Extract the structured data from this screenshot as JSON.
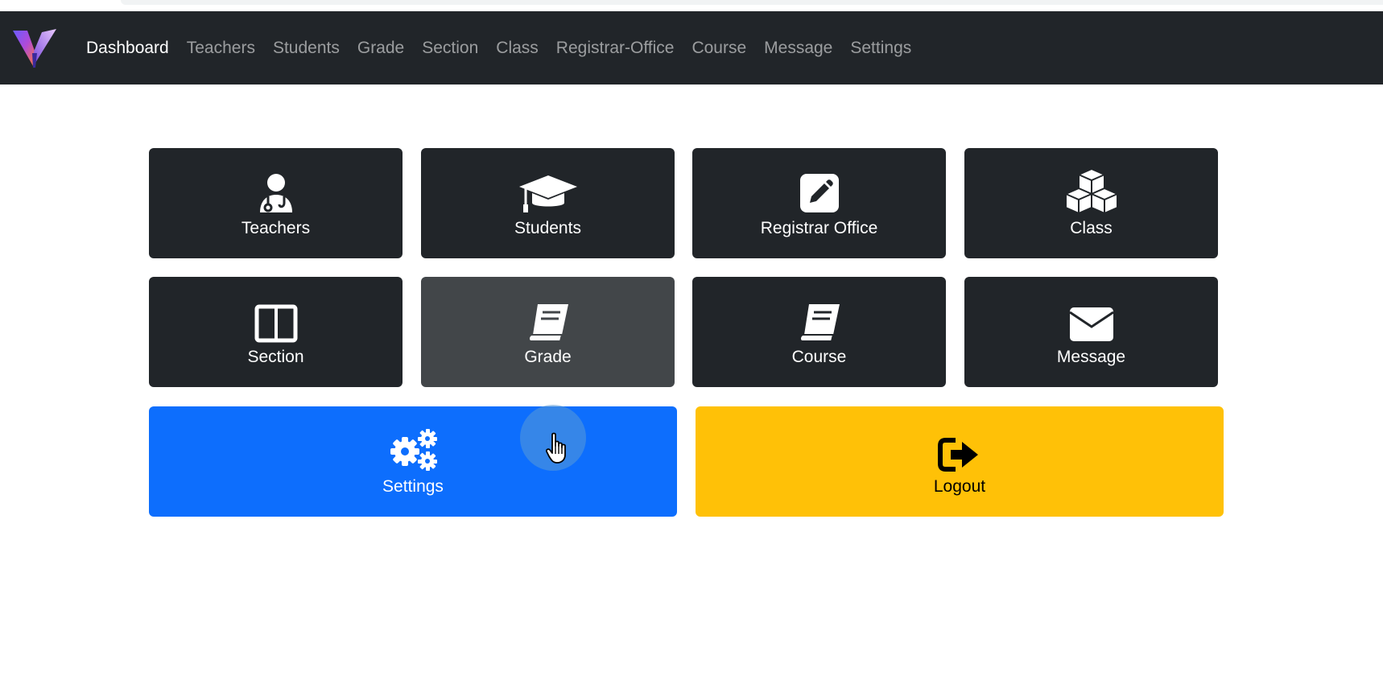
{
  "nav": {
    "links": [
      {
        "label": "Dashboard",
        "active": true
      },
      {
        "label": "Teachers"
      },
      {
        "label": "Students"
      },
      {
        "label": "Grade"
      },
      {
        "label": "Section"
      },
      {
        "label": "Class"
      },
      {
        "label": "Registrar-Office"
      },
      {
        "label": "Course"
      },
      {
        "label": "Message"
      },
      {
        "label": "Settings"
      }
    ]
  },
  "tiles": {
    "teachers": {
      "label": "Teachers",
      "icon": "user-doctor-icon"
    },
    "students": {
      "label": "Students",
      "icon": "graduation-cap-icon"
    },
    "registrar": {
      "label": "Registrar Office",
      "icon": "pen-square-icon"
    },
    "class": {
      "label": "Class",
      "icon": "cubes-icon"
    },
    "section": {
      "label": "Section",
      "icon": "columns-icon"
    },
    "grade": {
      "label": "Grade",
      "icon": "book-icon"
    },
    "course": {
      "label": "Course",
      "icon": "book-icon"
    },
    "message": {
      "label": "Message",
      "icon": "envelope-icon"
    },
    "settings": {
      "label": "Settings",
      "icon": "gears-icon"
    },
    "logout": {
      "label": "Logout",
      "icon": "sign-out-icon"
    }
  },
  "colors": {
    "navbar": "#212529",
    "tile_dark": "#212529",
    "tile_hover": "#424649",
    "settings_blue": "#0d6efd",
    "logout_yellow": "#ffc107"
  }
}
